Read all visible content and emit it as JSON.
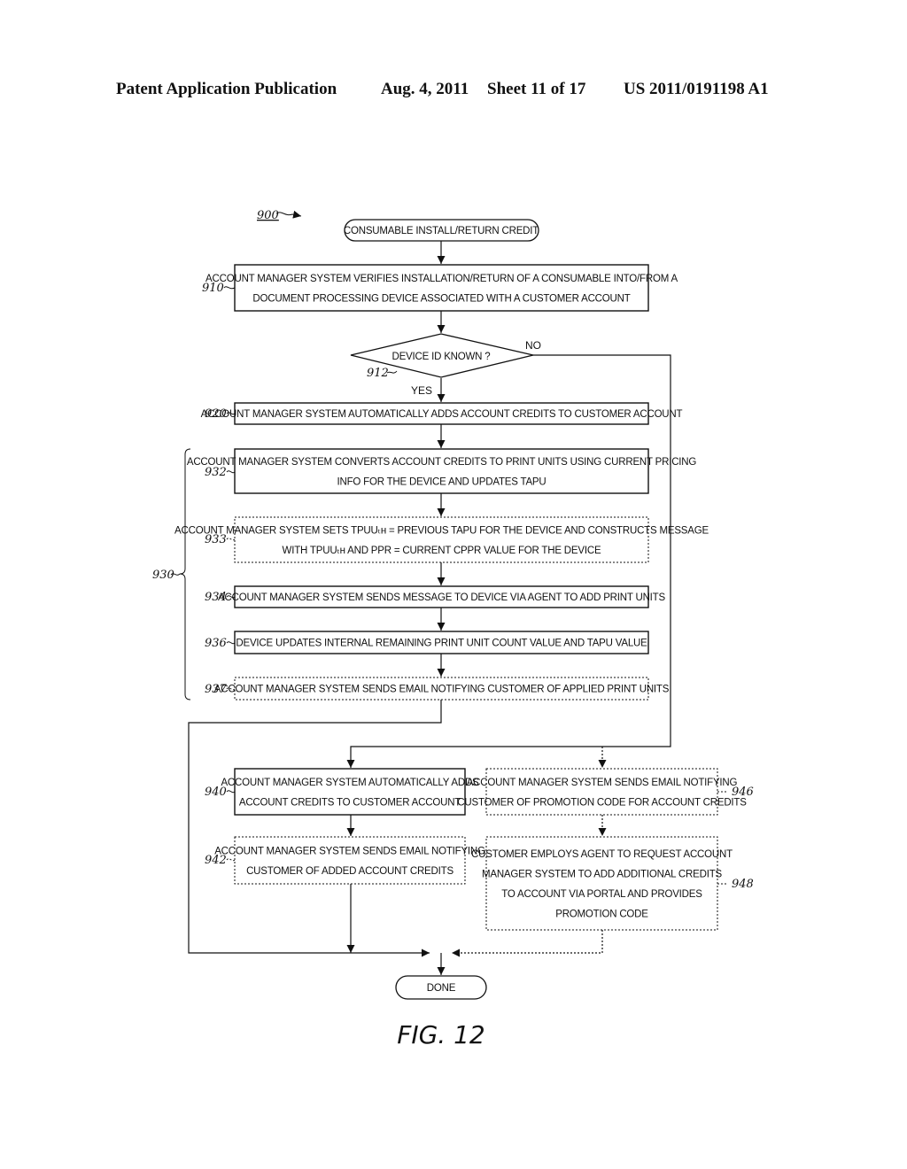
{
  "header": {
    "publication": "Patent Application Publication",
    "date": "Aug. 4, 2011",
    "sheet": "Sheet 11 of 17",
    "number": "US 2011/0191198 A1"
  },
  "diagram": {
    "figure_ref": "900",
    "figure_caption": "FIG. 12",
    "start": "CONSUMABLE INSTALL/RETURN CREDIT",
    "end": "DONE",
    "decision": {
      "ref": "912",
      "text": "DEVICE ID KNOWN ?",
      "yes": "YES",
      "no": "NO"
    },
    "group_ref": "930",
    "steps": [
      {
        "ref": "910",
        "style": "solid",
        "lines": [
          "ACCOUNT MANAGER SYSTEM VERIFIES INSTALLATION/RETURN OF A CONSUMABLE INTO/FROM A",
          "DOCUMENT PROCESSING DEVICE ASSOCIATED WITH A CUSTOMER ACCOUNT"
        ]
      },
      {
        "ref": "920",
        "style": "solid",
        "lines": [
          "ACCOUNT MANAGER SYSTEM AUTOMATICALLY ADDS ACCOUNT CREDITS TO CUSTOMER ACCOUNT"
        ]
      },
      {
        "ref": "932",
        "style": "solid",
        "lines": [
          "ACCOUNT MANAGER SYSTEM CONVERTS ACCOUNT CREDITS TO PRINT UNITS USING CURRENT PRICING",
          "INFO FOR THE DEVICE AND UPDATES TAPU"
        ]
      },
      {
        "ref": "933",
        "style": "dotted",
        "lines": [
          "ACCOUNT MANAGER SYSTEM SETS TPUUₜʜ = PREVIOUS TAPU FOR THE DEVICE AND CONSTRUCTS MESSAGE",
          "WITH TPUUₜʜ AND PPR = CURRENT CPPR VALUE FOR THE DEVICE"
        ]
      },
      {
        "ref": "934",
        "style": "solid",
        "lines": [
          "ACCOUNT MANAGER SYSTEM SENDS MESSAGE TO DEVICE VIA AGENT TO ADD PRINT UNITS"
        ]
      },
      {
        "ref": "936",
        "style": "solid",
        "lines": [
          "DEVICE UPDATES INTERNAL REMAINING PRINT UNIT COUNT VALUE AND TAPU VALUE"
        ]
      },
      {
        "ref": "937",
        "style": "dotted",
        "lines": [
          "ACCOUNT MANAGER SYSTEM SENDS EMAIL NOTIFYING CUSTOMER OF APPLIED PRINT UNITS"
        ]
      },
      {
        "ref": "940",
        "style": "solid",
        "lines": [
          "ACCOUNT MANAGER SYSTEM AUTOMATICALLY ADDS",
          "ACCOUNT CREDITS TO CUSTOMER ACCOUNT"
        ]
      },
      {
        "ref": "942",
        "style": "dotted",
        "lines": [
          "ACCOUNT MANAGER SYSTEM SENDS EMAIL NOTIFYING",
          "CUSTOMER OF ADDED ACCOUNT CREDITS"
        ]
      },
      {
        "ref": "946",
        "style": "dotted",
        "lines": [
          "ACCOUNT MANAGER SYSTEM SENDS EMAIL NOTIFYING",
          "CUSTOMER OF PROMOTION CODE FOR ACCOUNT CREDITS"
        ]
      },
      {
        "ref": "948",
        "style": "dotted",
        "lines": [
          "CUSTOMER EMPLOYS AGENT TO REQUEST ACCOUNT",
          "MANAGER SYSTEM TO ADD ADDITIONAL CREDITS",
          "TO ACCOUNT VIA PORTAL AND PROVIDES",
          "PROMOTION CODE"
        ]
      }
    ]
  }
}
